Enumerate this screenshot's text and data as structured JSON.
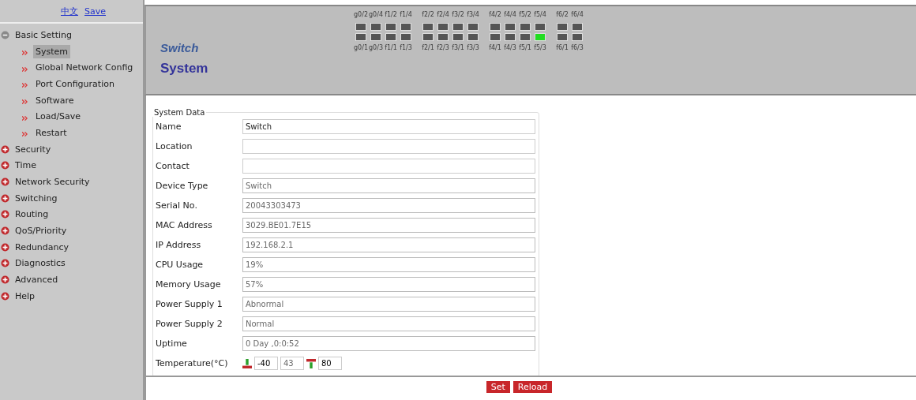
{
  "sidebar": {
    "links": [
      {
        "label": "中文"
      },
      {
        "label": "Save"
      }
    ],
    "tree": [
      {
        "label": "Basic Setting",
        "expanded": true,
        "children": [
          {
            "label": "System",
            "selected": true
          },
          {
            "label": "Global Network Config",
            "selected": false
          },
          {
            "label": "Port Configuration",
            "selected": false
          },
          {
            "label": "Software",
            "selected": false
          },
          {
            "label": "Load/Save",
            "selected": false
          },
          {
            "label": "Restart",
            "selected": false
          }
        ]
      },
      {
        "label": "Security",
        "expanded": false
      },
      {
        "label": "Time",
        "expanded": false
      },
      {
        "label": "Network Security",
        "expanded": false
      },
      {
        "label": "Switching",
        "expanded": false
      },
      {
        "label": "Routing",
        "expanded": false
      },
      {
        "label": "QoS/Priority",
        "expanded": false
      },
      {
        "label": "Redundancy",
        "expanded": false
      },
      {
        "label": "Diagnostics",
        "expanded": false
      },
      {
        "label": "Advanced",
        "expanded": false
      },
      {
        "label": "Help",
        "expanded": false
      }
    ]
  },
  "header": {
    "device": "Switch",
    "page": "System",
    "port_groups": [
      {
        "columns": [
          {
            "top": {
              "label": "g0/2",
              "link": false
            },
            "bottom": {
              "label": "g0/1",
              "link": false
            }
          },
          {
            "top": {
              "label": "g0/4",
              "link": false
            },
            "bottom": {
              "label": "g0/3",
              "link": false
            }
          },
          {
            "top": {
              "label": "f1/2",
              "link": false
            },
            "bottom": {
              "label": "f1/1",
              "link": false
            }
          },
          {
            "top": {
              "label": "f1/4",
              "link": false
            },
            "bottom": {
              "label": "f1/3",
              "link": false
            }
          }
        ]
      },
      {
        "columns": [
          {
            "top": {
              "label": "f2/2",
              "link": false
            },
            "bottom": {
              "label": "f2/1",
              "link": false
            }
          },
          {
            "top": {
              "label": "f2/4",
              "link": false
            },
            "bottom": {
              "label": "f2/3",
              "link": false
            }
          },
          {
            "top": {
              "label": "f3/2",
              "link": false
            },
            "bottom": {
              "label": "f3/1",
              "link": false
            }
          },
          {
            "top": {
              "label": "f3/4",
              "link": false
            },
            "bottom": {
              "label": "f3/3",
              "link": false
            }
          }
        ]
      },
      {
        "columns": [
          {
            "top": {
              "label": "f4/2",
              "link": false
            },
            "bottom": {
              "label": "f4/1",
              "link": false
            }
          },
          {
            "top": {
              "label": "f4/4",
              "link": false
            },
            "bottom": {
              "label": "f4/3",
              "link": false
            }
          },
          {
            "top": {
              "label": "f5/2",
              "link": false
            },
            "bottom": {
              "label": "f5/1",
              "link": false
            }
          },
          {
            "top": {
              "label": "f5/4",
              "link": false
            },
            "bottom": {
              "label": "f5/3",
              "link": true
            }
          }
        ]
      },
      {
        "columns": [
          {
            "top": {
              "label": "f6/2",
              "link": false
            },
            "bottom": {
              "label": "f6/1",
              "link": false
            }
          },
          {
            "top": {
              "label": "f6/4",
              "link": false
            },
            "bottom": {
              "label": "f6/3",
              "link": false
            }
          }
        ]
      }
    ]
  },
  "form": {
    "legend": "System Data",
    "fields": [
      {
        "label": "Name",
        "value": "Switch",
        "readonly": false
      },
      {
        "label": "Location",
        "readonly": false
      },
      {
        "label": "Contact",
        "readonly": false
      },
      {
        "label": "Device Type",
        "value": "Switch",
        "readonly": true
      },
      {
        "label": "Serial No.",
        "value": "20043303473",
        "readonly": true
      },
      {
        "label": "MAC Address",
        "value": "3029.BE01.7E15",
        "readonly": true
      },
      {
        "label": "IP Address",
        "value": "192.168.2.1",
        "readonly": true
      },
      {
        "label": "CPU Usage",
        "value": "19%",
        "readonly": true
      },
      {
        "label": "Memory Usage",
        "value": "57%",
        "readonly": true
      },
      {
        "label": "Power Supply 1",
        "value": "Abnormal",
        "readonly": true
      },
      {
        "label": "Power Supply 2",
        "value": "Normal",
        "readonly": true
      },
      {
        "label": "Uptime",
        "value": "0 Day ,0:0:52",
        "readonly": true
      }
    ],
    "temperature": {
      "label": "Temperature(°C)",
      "low": "-40",
      "current": "43",
      "high": "80"
    }
  },
  "buttons": [
    {
      "label": "Set"
    },
    {
      "label": "Reload"
    }
  ]
}
